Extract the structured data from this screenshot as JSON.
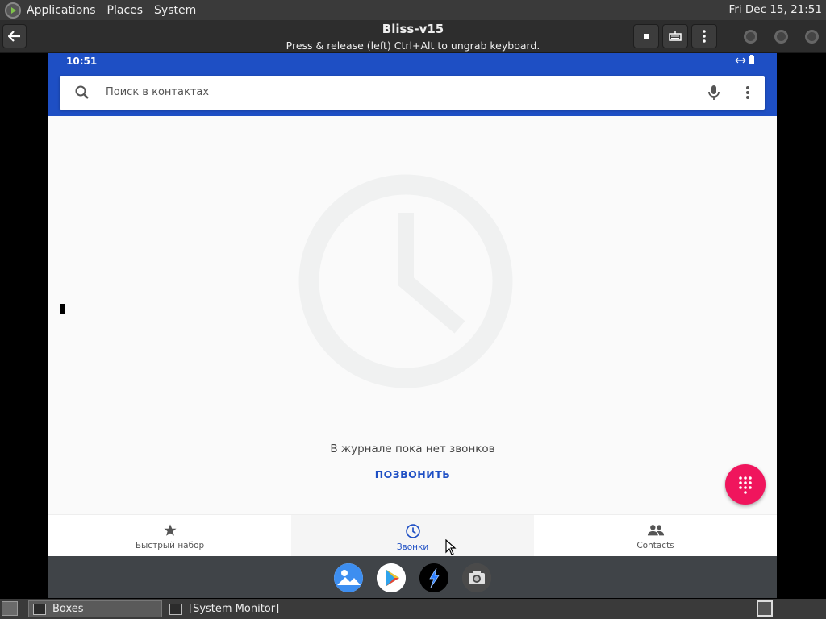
{
  "top_panel": {
    "menus": [
      "Applications",
      "Places",
      "System"
    ],
    "clock": "Fri Dec 15, 21:51"
  },
  "headerbar": {
    "title": "Bliss-v15",
    "subtitle": "Press & release (left) Ctrl+Alt to ungrab keyboard."
  },
  "android": {
    "status_time": "10:51",
    "search_placeholder": "Поиск в контактах",
    "empty_message": "В журнале пока нет звонков",
    "call_action": "ПОЗВОНИТЬ",
    "nav": [
      {
        "label": "Быстрый набор",
        "icon": "star-icon",
        "active": false
      },
      {
        "label": "Звонки",
        "icon": "clock-icon",
        "active": true
      },
      {
        "label": "Contacts",
        "icon": "people-icon",
        "active": false
      }
    ],
    "dock": [
      "gallery-icon",
      "play-store-icon",
      "browser-icon",
      "camera-icon"
    ],
    "colors": {
      "accent": "#1e4fc4",
      "fab": "#f0155d"
    }
  },
  "taskbar": {
    "tasks": [
      "Boxes",
      "[System Monitor]"
    ]
  }
}
